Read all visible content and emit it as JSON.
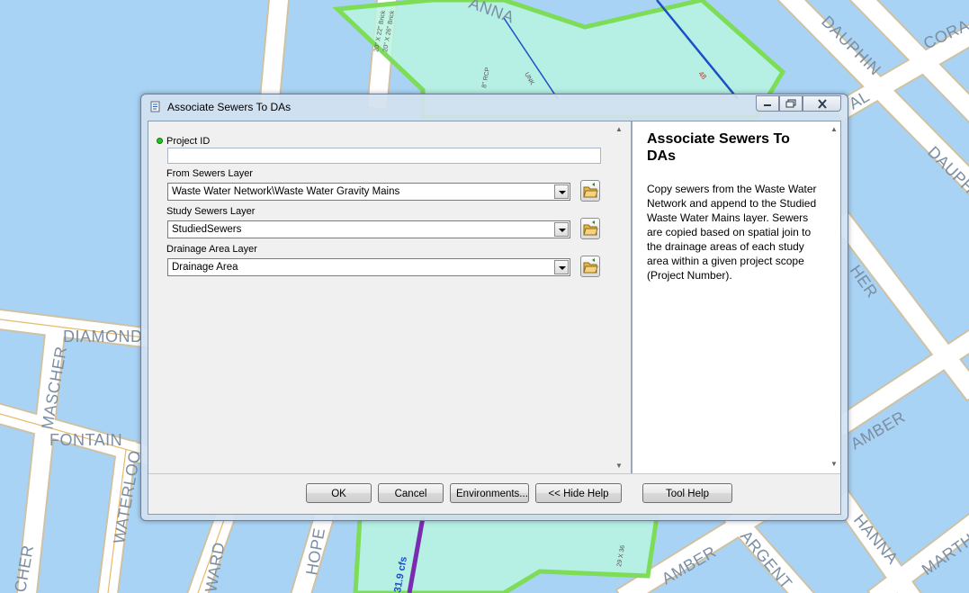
{
  "window": {
    "title": "Associate Sewers To DAs",
    "controls": [
      "minimize-icon",
      "maximize-icon",
      "close-icon"
    ]
  },
  "parameters": {
    "project_id": {
      "label": "Project ID",
      "value": ""
    },
    "from_sewers": {
      "label": "From Sewers Layer",
      "value": "Waste Water Network\\Waste Water Gravity Mains"
    },
    "study_sewers": {
      "label": "Study Sewers Layer",
      "value": "StudiedSewers"
    },
    "drainage_area": {
      "label": "Drainage Area Layer",
      "value": "Drainage Area"
    }
  },
  "help": {
    "title": "Associate Sewers To DAs",
    "body": "Copy sewers from the Waste Water Network and append to the Studied Waste Water Mains layer. Sewers are copied based on spatial join to the drainage areas of each study area within a given project scope (Project Number)."
  },
  "buttons": {
    "ok": "OK",
    "cancel": "Cancel",
    "environments": "Environments...",
    "hide_help": "<< Hide Help",
    "tool_help": "Tool Help"
  },
  "map": {
    "street_labels": [
      "DAUPHIN",
      "CORA",
      "DAUPHIN",
      "AL",
      "DIAMOND",
      "MASCHER",
      "FONTAIN",
      "WATERLOO",
      "CHER",
      "WARD",
      "HOPE",
      "AMBER",
      "AMBER",
      "ARGENT",
      "HANNA",
      "MARTH",
      "HER",
      "ANNA"
    ],
    "annotations": [
      "20\" X 22\" Brick",
      "20\" X 26\" Brick",
      "8\" RCP",
      "UNK",
      "48",
      "31.9 cfs",
      "29 X 36"
    ]
  },
  "colors": {
    "water": "#a9d3f4",
    "land": "#ffffff",
    "street_casing": "#d8c8a0",
    "drainage_area_fill": "#b9f3df",
    "drainage_area_outline": "#7ddd56",
    "sewer_main": "#1a4fc7"
  }
}
